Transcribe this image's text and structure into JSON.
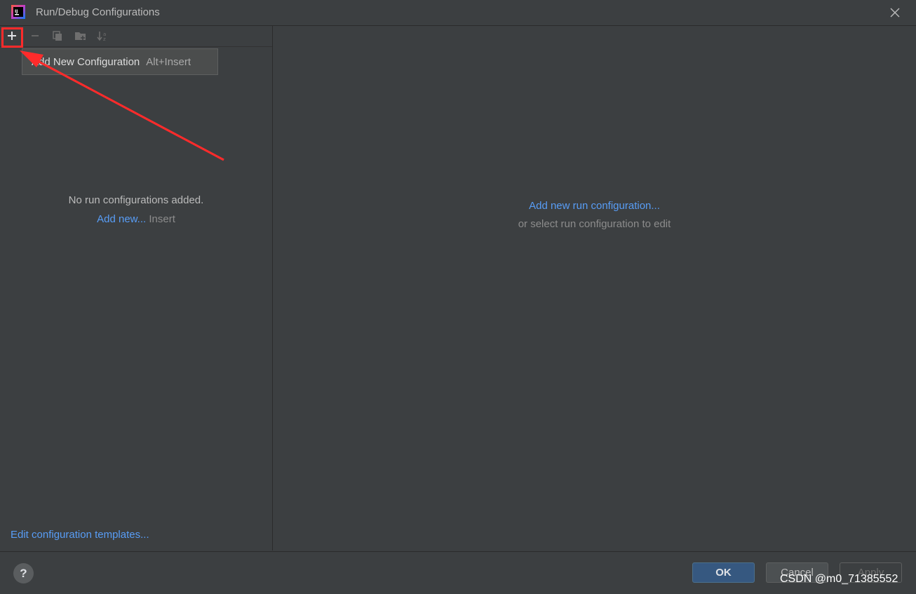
{
  "window": {
    "title": "Run/Debug Configurations",
    "app_icon": "intellij-idea-icon",
    "close_icon": "close-icon"
  },
  "toolbar": {
    "icons": [
      "add-icon",
      "remove-icon",
      "copy-icon",
      "new-folder-icon",
      "sort-icon"
    ]
  },
  "tooltip": {
    "label": "Add New Configuration",
    "shortcut": "Alt+Insert"
  },
  "left_pane": {
    "empty_message": "No run configurations added.",
    "add_new_link": "Add new...",
    "add_new_shortcut": "Insert",
    "templates_link": "Edit configuration templates..."
  },
  "right_pane": {
    "add_link": "Add new run configuration...",
    "hint": "or select run configuration to edit"
  },
  "footer": {
    "help_label": "?",
    "ok_label": "OK",
    "cancel_label": "Cancel",
    "apply_label": "Apply"
  },
  "watermark": "CSDN @m0_71385552",
  "colors": {
    "background": "#3c3f41",
    "link": "#589df6",
    "annotation": "#ff2b2b",
    "ok_button": "#365880"
  }
}
